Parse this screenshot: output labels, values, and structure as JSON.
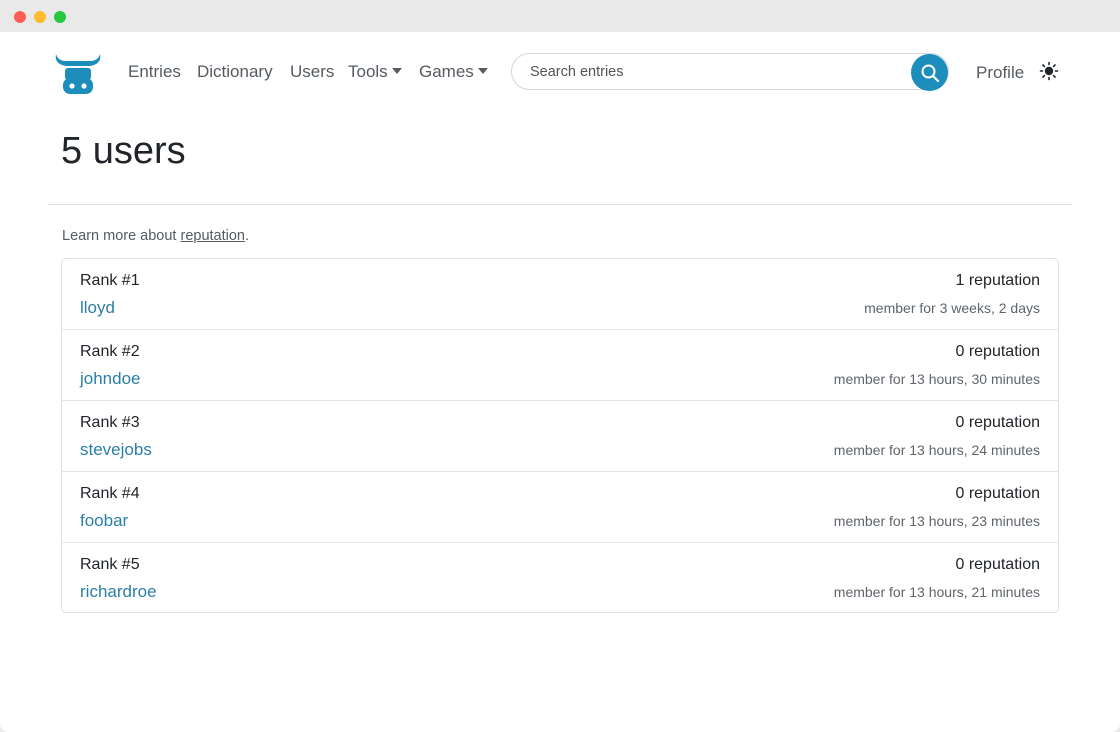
{
  "nav": {
    "links": [
      "Entries",
      "Dictionary",
      "Users"
    ],
    "tools_label": "Tools",
    "games_label": "Games",
    "profile_label": "Profile",
    "search_placeholder": "Search entries",
    "icons": {
      "logo": "bull-logo-icon",
      "search": "search-icon",
      "theme": "sun-icon"
    },
    "accent_color": "#1d8dbb"
  },
  "page": {
    "title": "5 users",
    "learn_prefix": "Learn more about ",
    "learn_link": "reputation",
    "learn_suffix": "."
  },
  "users": [
    {
      "rank": "Rank #1",
      "name": "lloyd",
      "reputation": "1 reputation",
      "member": "member for 3 weeks, 2 days"
    },
    {
      "rank": "Rank #2",
      "name": "johndoe",
      "reputation": "0 reputation",
      "member": "member for 13 hours, 30 minutes"
    },
    {
      "rank": "Rank #3",
      "name": "stevejobs",
      "reputation": "0 reputation",
      "member": "member for 13 hours, 24 minutes"
    },
    {
      "rank": "Rank #4",
      "name": "foobar",
      "reputation": "0 reputation",
      "member": "member for 13 hours, 23 minutes"
    },
    {
      "rank": "Rank #5",
      "name": "richardroe",
      "reputation": "0 reputation",
      "member": "member for 13 hours, 21 minutes"
    }
  ]
}
